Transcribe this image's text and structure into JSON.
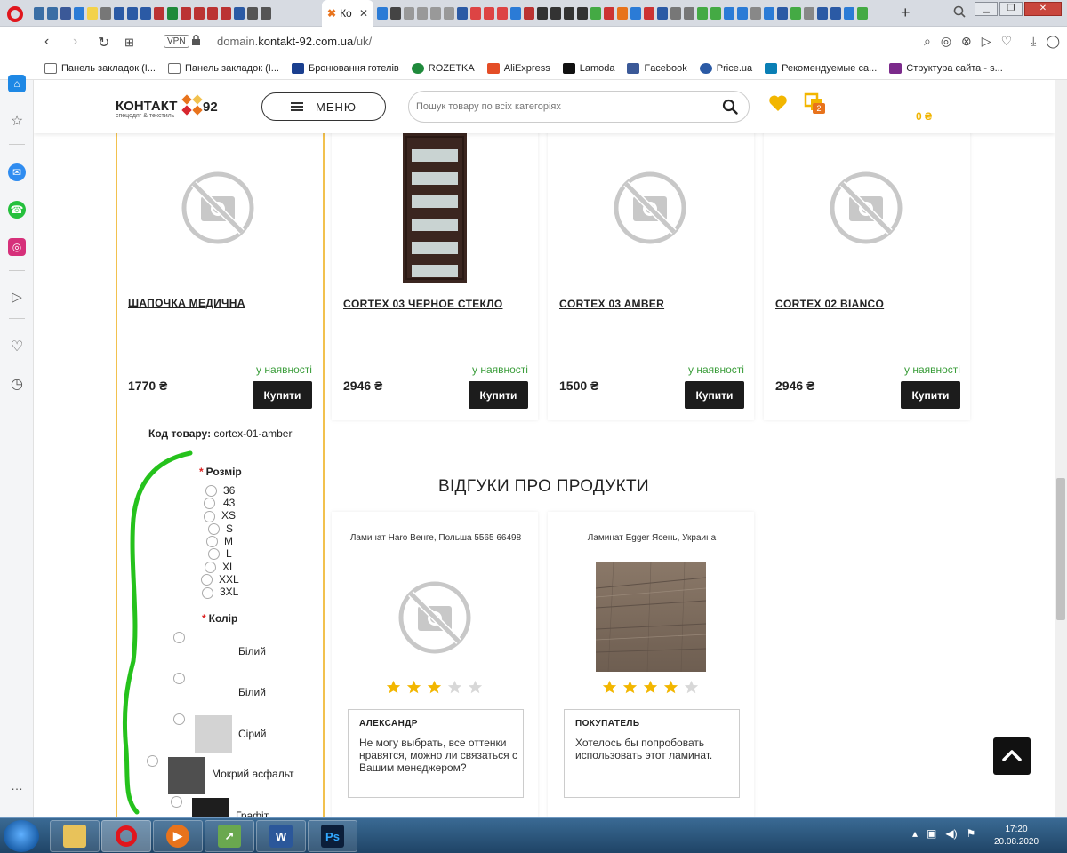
{
  "browser": {
    "active_tab_label": "Ко",
    "url_domain": "domain.",
    "url_host": "kontakt-92.com.ua",
    "url_path": "/uk/",
    "vpn_label": "VPN"
  },
  "bookmarks": [
    {
      "label": "Панель закладок (І...",
      "color": "#6b6b6b"
    },
    {
      "label": "Панель закладок (І...",
      "color": "#6b6b6b"
    },
    {
      "label": "Бронювання готелів",
      "color": "#1a3f8f"
    },
    {
      "label": "ROZETKA",
      "color": "#1f8a3b"
    },
    {
      "label": "AliExpress",
      "color": "#e44d26"
    },
    {
      "label": "Lamoda",
      "color": "#111111"
    },
    {
      "label": "Facebook",
      "color": "#3b5998"
    },
    {
      "label": "Price.ua",
      "color": "#2b5aa5"
    },
    {
      "label": "Рекомендуемые са...",
      "color": "#0a7fb5"
    },
    {
      "label": "Структура сайта - s...",
      "color": "#7b2a8b"
    }
  ],
  "header": {
    "logo_text": "КОНТАКТ",
    "logo_number": "92",
    "logo_sub": "спецодяг & текстиль",
    "menu_label": "МЕНЮ",
    "search_placeholder": "Пошук товару по всіх категоріях",
    "cart_count": "2",
    "cart_total": "0 ₴"
  },
  "products": [
    {
      "title": "ШАПОЧКА МЕДИЧНА",
      "stock": "у наявності",
      "price": "1770 ₴",
      "buy": "Купити"
    },
    {
      "title": "CORTEX 03 ЧЕРНОЕ СТЕКЛО",
      "stock": "у наявності",
      "price": "2946 ₴",
      "buy": "Купити"
    },
    {
      "title": "CORTEX 03 AMBER",
      "stock": "у наявності",
      "price": "1500 ₴",
      "buy": "Купити"
    },
    {
      "title": "CORTEX 02 BIANCO",
      "stock": "у наявності",
      "price": "2946 ₴",
      "buy": "Купити"
    }
  ],
  "product_options": {
    "sku_label": "Код товару:",
    "sku_value": "cortex-01-amber",
    "size_title": "Розмір",
    "sizes": [
      "36",
      "43",
      "XS",
      "S",
      "M",
      "L",
      "XL",
      "XXL",
      "3XL"
    ],
    "color_title": "Колір",
    "colors": [
      {
        "name": "Білий",
        "swatch": "#ffffff"
      },
      {
        "name": "Білий",
        "swatch": "#ffffff"
      },
      {
        "name": "Сірий",
        "swatch": "#d3d3d3"
      },
      {
        "name": "Мокрий асфальт",
        "swatch": "#4f4f4f"
      },
      {
        "name": "Графіт",
        "swatch": "#1e1e1e"
      }
    ]
  },
  "reviews": {
    "title": "ВІДГУКИ ПРО ПРОДУКТИ",
    "items": [
      {
        "product": "Ламинат Haro Венге, Польша 5565 66498",
        "rating": 3,
        "author": "АЛЕКСАНДР",
        "text": "Не могу выбрать, все оттенки нравятся, можно ли связаться с Вашим менеджером?"
      },
      {
        "product": "Ламинат Egger Ясень, Украина",
        "rating": 4,
        "author": "ПОКУПАТЕЛЬ",
        "text": "Хотелось бы попробовать использовать этот ламинат."
      }
    ]
  },
  "taskbar": {
    "time": "17:20",
    "date": "20.08.2020"
  },
  "colors": {
    "accent_yellow": "#f2c14e",
    "stock_green": "#3a9d3a",
    "buy_button": "#1c1c1c",
    "star_on": "#f2b600",
    "star_off": "#d8d8d8"
  }
}
